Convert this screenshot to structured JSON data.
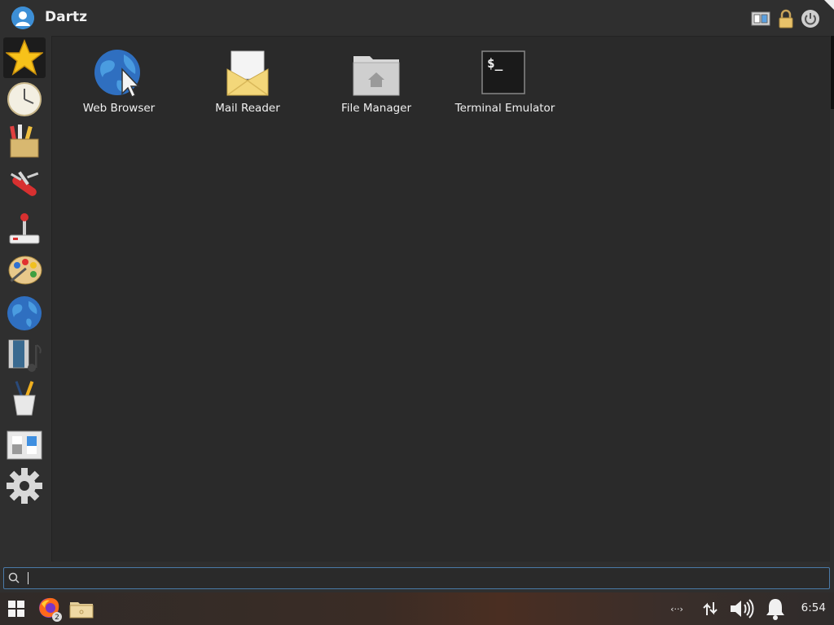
{
  "header": {
    "user_name": "Dartz",
    "buttons": [
      {
        "name": "switch-user-button",
        "icon": "switch-user-icon"
      },
      {
        "name": "lock-screen-button",
        "icon": "lock-icon"
      },
      {
        "name": "logout-button",
        "icon": "power-icon"
      }
    ]
  },
  "sidebar": {
    "categories": [
      {
        "id": "favorites",
        "icon": "star-icon",
        "active": true
      },
      {
        "id": "recently-used",
        "icon": "clock-icon"
      },
      {
        "id": "accessories",
        "icon": "accessories-icon"
      },
      {
        "id": "system",
        "icon": "swiss-knife-icon"
      },
      {
        "id": "games",
        "icon": "joystick-icon"
      },
      {
        "id": "graphics",
        "icon": "palette-icon"
      },
      {
        "id": "internet",
        "icon": "globe-icon"
      },
      {
        "id": "multimedia",
        "icon": "multimedia-icon"
      },
      {
        "id": "office",
        "icon": "pencil-cup-icon"
      },
      {
        "id": "settings-manager",
        "icon": "settings-manager-icon"
      },
      {
        "id": "settings",
        "icon": "gear-icon"
      }
    ]
  },
  "favorites": [
    {
      "label": "Web Browser",
      "icon": "web-browser-icon"
    },
    {
      "label": "Mail Reader",
      "icon": "mail-icon"
    },
    {
      "label": "File Manager",
      "icon": "folder-home-icon"
    },
    {
      "label": "Terminal Emulator",
      "icon": "terminal-icon",
      "glyph": "$_"
    }
  ],
  "search": {
    "value": "",
    "placeholder": ""
  },
  "taskbar": {
    "items": [
      {
        "name": "whisker-menu-button",
        "icon": "windows-logo-icon"
      },
      {
        "name": "firefox-button",
        "icon": "firefox-icon",
        "badge": "2"
      },
      {
        "name": "files-button",
        "icon": "folder-icon"
      }
    ],
    "tray": [
      {
        "name": "network-code-indicator",
        "icon": "code-brackets-icon",
        "text": "‹··›"
      },
      {
        "name": "network-indicator",
        "icon": "network-arrows-icon"
      },
      {
        "name": "volume-indicator",
        "icon": "volume-icon"
      },
      {
        "name": "notifications-indicator",
        "icon": "bell-icon"
      }
    ],
    "clock": "6:54"
  },
  "colors": {
    "accent": "#4a7aa8",
    "panel_bg": "#2f2f2f",
    "content_bg": "#2a2a2a"
  }
}
